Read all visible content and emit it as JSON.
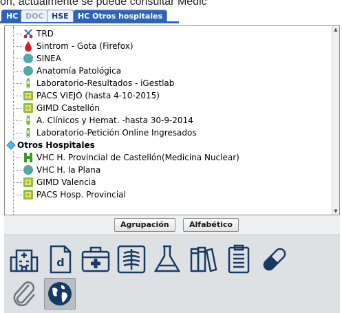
{
  "top_text": "ón, actualmente se puede consultar Medic",
  "tabs": [
    {
      "label": "HC"
    },
    {
      "label": "DOC"
    },
    {
      "label": "HSE"
    },
    {
      "label": "HC Otros hospitales"
    }
  ],
  "tree_items": [
    {
      "label": "TRD",
      "icon": "scissors-icon"
    },
    {
      "label": "Sintrom - Gota (Firefox)",
      "icon": "blood-drop-icon"
    },
    {
      "label": "SINEA",
      "icon": "globe-icon"
    },
    {
      "label": "Anatomía Patológica",
      "icon": "globe-icon"
    },
    {
      "label": "Laboratorio-Resultados - iGestlab",
      "icon": "test-tube-icon"
    },
    {
      "label": "PACS VIEJO (hasta 4-10-2015)",
      "icon": "pacs-icon"
    },
    {
      "label": "GIMD Castellón",
      "icon": "pacs-icon"
    },
    {
      "label": "A. Clínicos y Hemat. -hasta 30-9-2014",
      "icon": "test-tube-icon"
    },
    {
      "label": "Laboratorio-Petición Online Ingresados",
      "icon": "test-tube-icon"
    }
  ],
  "group": {
    "label": "Otros Hospitales",
    "icon": "diamond-icon"
  },
  "group_items": [
    {
      "label": "VHC H. Provincial de Castellón(Medicina Nuclear)",
      "icon": "h-icon"
    },
    {
      "label": "VHC H. la Plana",
      "icon": "globe-icon"
    },
    {
      "label": "GIMD Valencia",
      "icon": "pacs-icon"
    },
    {
      "label": "PACS Hosp. Provincial",
      "icon": "pacs-icon"
    }
  ],
  "buttons": {
    "group_label": "Agrupación",
    "alpha_label": "Alfabético"
  },
  "bottom_icons": [
    "hospital-icon",
    "document-d-icon",
    "medical-kit-icon",
    "xray-icon",
    "flask-icon",
    "books-icon",
    "clipboard-icon",
    "pill-icon",
    "paperclip-icon",
    "globe-icon"
  ],
  "colors": {
    "tab_blue": "#2f64b5",
    "icon_green": "#7fb040",
    "accent_red": "#d0202a"
  }
}
